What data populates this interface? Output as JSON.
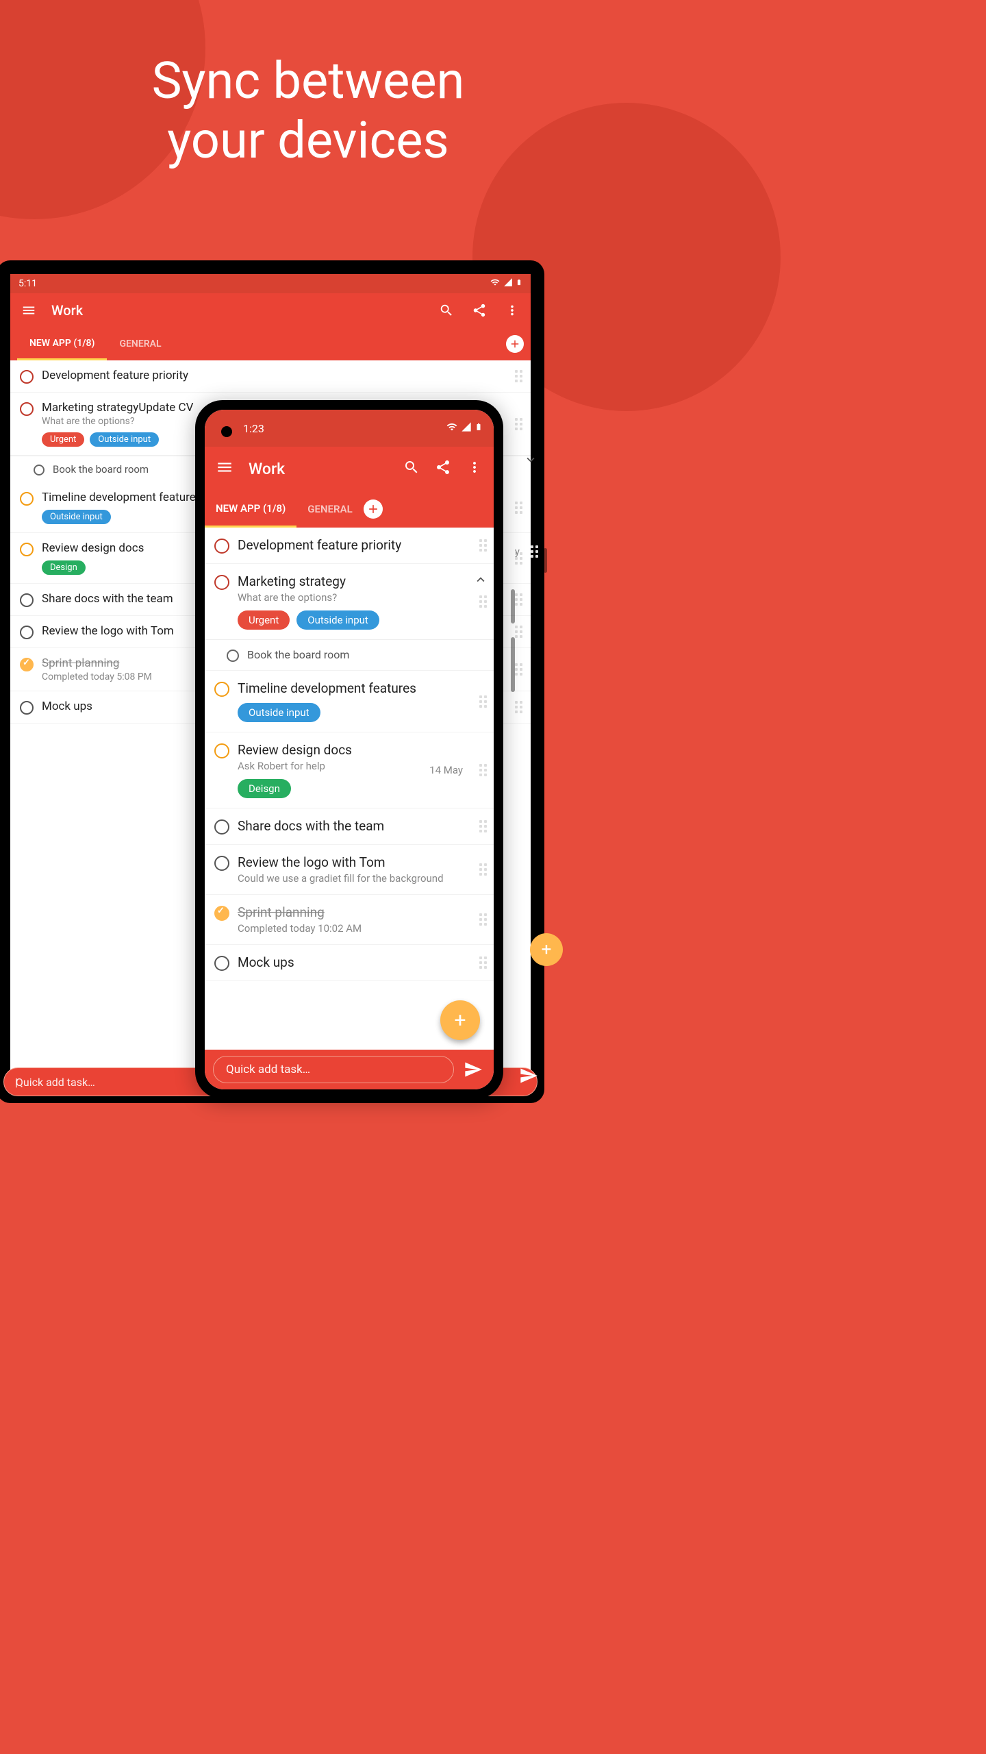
{
  "headline": "Sync between\nyour devices",
  "tablet": {
    "status_time": "5:11",
    "appbar_title": "Work",
    "tabs": {
      "active": "NEW APP (1/8)",
      "other": "GENERAL"
    },
    "items": [
      {
        "bullet": "red",
        "title": "Development feature priority"
      },
      {
        "bullet": "red",
        "title": "Marketing strategyUpdate CV",
        "sub": "What are the options?",
        "chips": [
          {
            "text": "Urgent",
            "c": "red"
          },
          {
            "text": "Outside input",
            "c": "blue"
          }
        ],
        "expand": "down",
        "subtasks": [
          {
            "title": "Book the board room"
          }
        ]
      },
      {
        "bullet": "orange",
        "title": "Timeline development features",
        "chips": [
          {
            "text": "Outside input",
            "c": "blue"
          }
        ]
      },
      {
        "bullet": "orange",
        "title": "Review design docs",
        "chips": [
          {
            "text": "Design",
            "c": "green"
          }
        ]
      },
      {
        "bullet": "grey",
        "title": "Share docs with the team"
      },
      {
        "bullet": "grey",
        "title": "Review the logo with Tom"
      },
      {
        "bullet": "done",
        "title": "Sprint planning",
        "completed": true,
        "sub": "Completed today 5:08 PM"
      },
      {
        "bullet": "grey",
        "title": "Mock ups"
      }
    ],
    "peek_date": "y",
    "quickadd": "Quick add task…"
  },
  "phone": {
    "status_time": "1:23",
    "appbar_title": "Work",
    "tabs": {
      "active": "NEW APP (1/8)",
      "other": "GENERAL"
    },
    "items": [
      {
        "bullet": "red",
        "title": "Development feature priority"
      },
      {
        "bullet": "red",
        "title": "Marketing strategy",
        "sub": "What are the options?",
        "chips": [
          {
            "text": "Urgent",
            "c": "red"
          },
          {
            "text": "Outside input",
            "c": "blue"
          }
        ],
        "expand": "up",
        "subtasks": [
          {
            "title": "Book the board room"
          }
        ]
      },
      {
        "bullet": "orange",
        "title": "Timeline development features",
        "chips": [
          {
            "text": "Outside input",
            "c": "blue"
          }
        ]
      },
      {
        "bullet": "orange",
        "title": "Review design docs",
        "sub": "Ask Robert for help",
        "date": "14 May",
        "chips": [
          {
            "text": "Deisgn",
            "c": "green"
          }
        ]
      },
      {
        "bullet": "grey",
        "title": "Share docs with the team"
      },
      {
        "bullet": "grey",
        "title": "Review the logo with Tom",
        "sub": "Could we use a gradiet fill for the background"
      },
      {
        "bullet": "done",
        "title": "Sprint planning",
        "completed": true,
        "sub": "Completed today 10:02 AM"
      },
      {
        "bullet": "grey",
        "title": "Mock ups"
      }
    ],
    "quickadd": "Quick add task…"
  }
}
